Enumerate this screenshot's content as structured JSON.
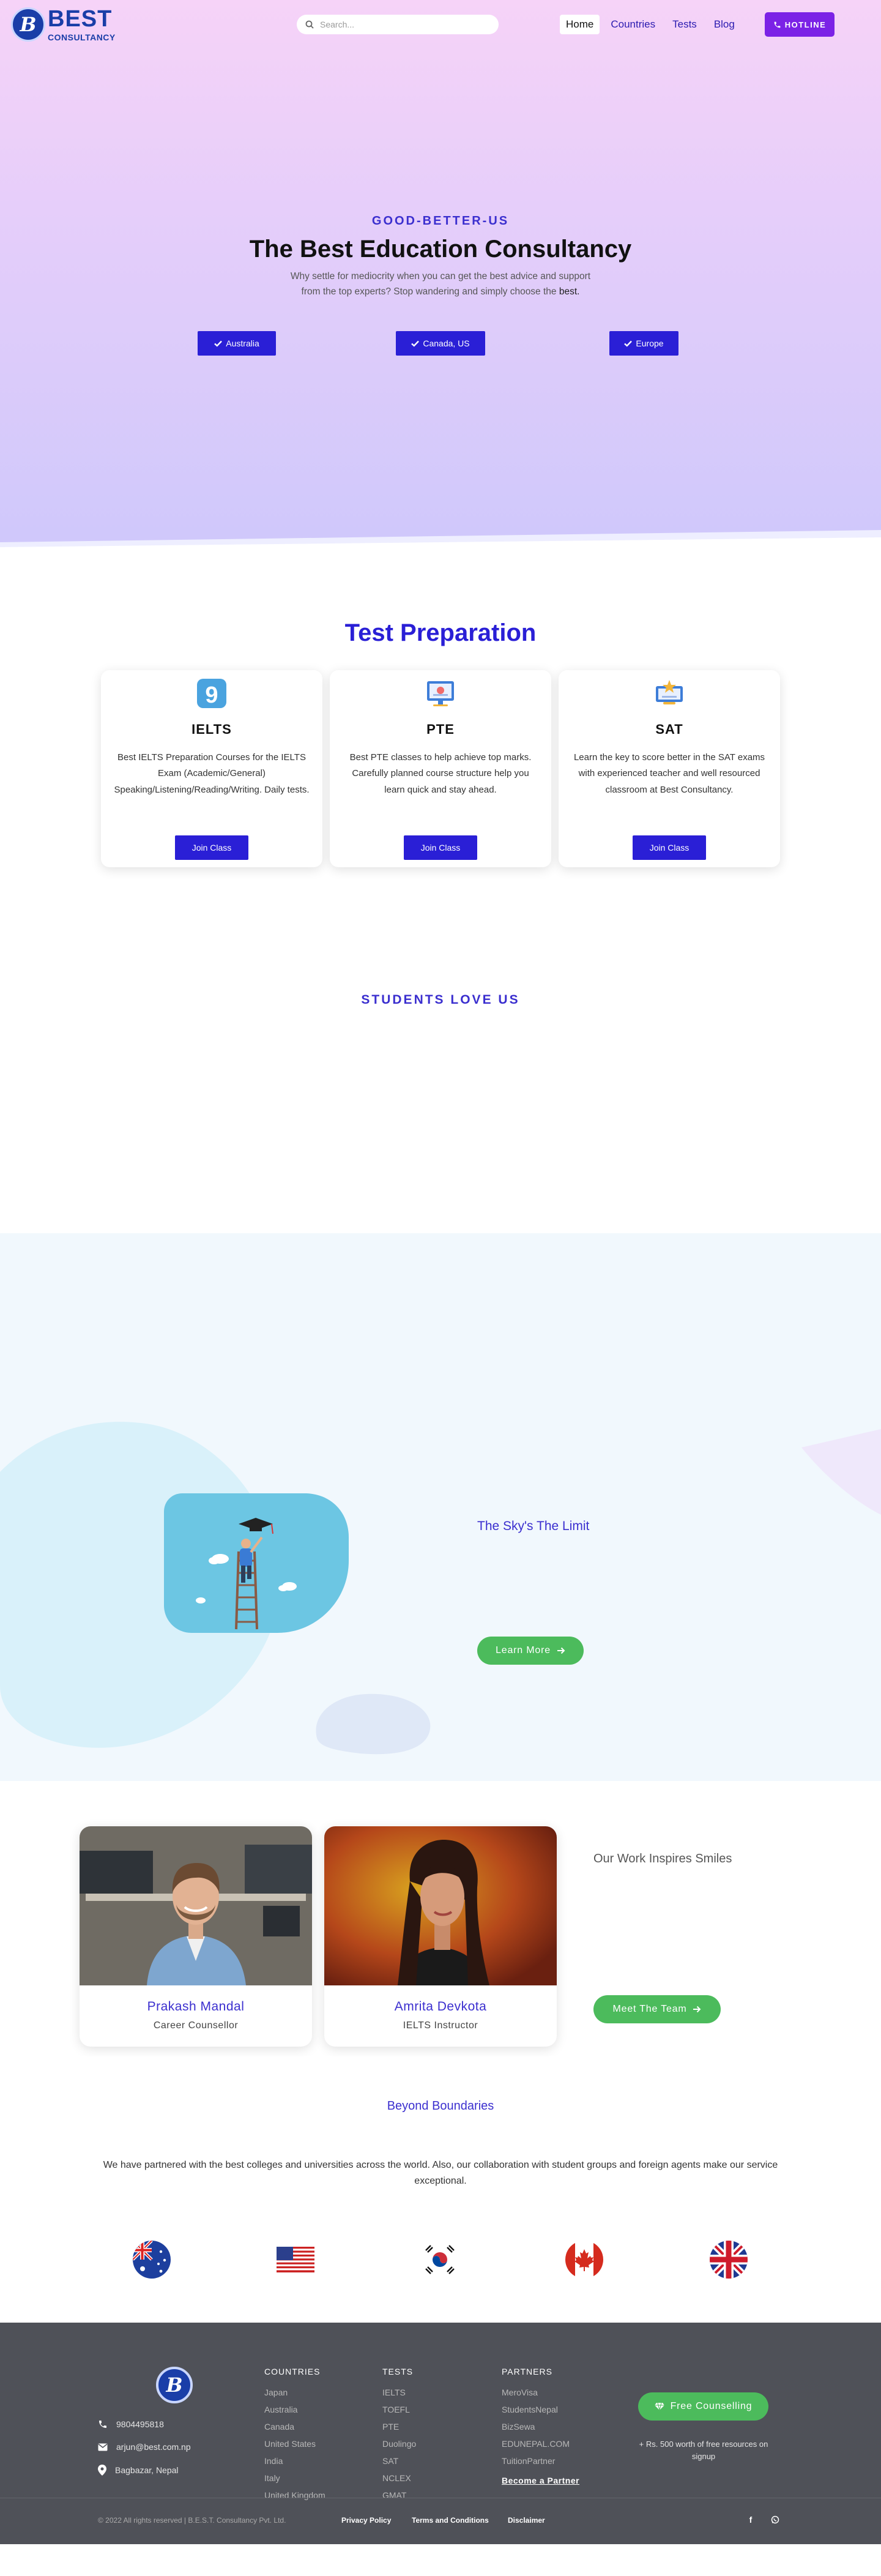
{
  "brand": {
    "logo_letter": "B",
    "name": "BEST",
    "tagline": "CONSULTANCY"
  },
  "search": {
    "placeholder": "Search..."
  },
  "nav": {
    "items": [
      {
        "label": "Home"
      },
      {
        "label": "Countries"
      },
      {
        "label": "Tests"
      },
      {
        "label": "Blog"
      }
    ],
    "hotline_label": "HOTLINE"
  },
  "hero": {
    "eyebrow": "GOOD-BETTER-US",
    "title": "The Best Education Consultancy",
    "description": "Why settle for mediocrity when you can get the best advice and support from the top experts? Stop wandering and simply choose the",
    "description_emphasis": "best.",
    "buttons": [
      {
        "label": "Australia"
      },
      {
        "label": "Canada, US"
      },
      {
        "label": "Europe"
      }
    ]
  },
  "test_prep": {
    "title": "Test Preparation",
    "cards": [
      {
        "name": "IELTS",
        "icon_text": "9",
        "description": "Best IELTS Preparation Courses for the IELTS Exam (Academic/General) Speaking/Listening/Reading/Writing. Daily tests.",
        "button": "Join Class"
      },
      {
        "name": "PTE",
        "description": "Best PTE classes to help achieve top marks. Carefully planned course structure help you learn quick and stay ahead.",
        "button": "Join Class"
      },
      {
        "name": "SAT",
        "description": "Learn the key to score better in the SAT exams with experienced teacher and well resourced classroom at Best Consultancy.",
        "button": "Join Class"
      }
    ]
  },
  "students": {
    "title": "STUDENTS LOVE US"
  },
  "sky": {
    "title": "The Sky's The Limit",
    "button": "Learn More"
  },
  "team": {
    "title": "Our Work Inspires Smiles",
    "button": "Meet The Team",
    "members": [
      {
        "name": "Prakash Mandal",
        "role": "Career Counsellor"
      },
      {
        "name": "Amrita Devkota",
        "role": "IELTS Instructor"
      }
    ]
  },
  "beyond": {
    "title": "Beyond Boundaries",
    "description": "We have partnered with the best colleges and universities across the world. Also, our collaboration with student groups and foreign agents make our service exceptional."
  },
  "footer": {
    "contact": {
      "phone": "9804495818",
      "email": "arjun@best.com.np",
      "address": "Bagbazar, Nepal"
    },
    "countries": {
      "heading": "COUNTRIES",
      "items": [
        "Japan",
        "Australia",
        "Canada",
        "United States",
        "India",
        "Italy",
        "United Kingdom"
      ]
    },
    "tests": {
      "heading": "TESTS",
      "items": [
        "IELTS",
        "TOEFL",
        "PTE",
        "Duolingo",
        "SAT",
        "NCLEX",
        "GMAT"
      ]
    },
    "partners": {
      "heading": "PARTNERS",
      "items": [
        "MeroVisa",
        "StudentsNepal",
        "BizSewa",
        "EDUNEPAL.COM",
        "TuitionPartner"
      ],
      "cta": "Become a Partner"
    },
    "counselling_button": "Free Counselling",
    "counselling_note": "+ Rs. 500 worth of free resources on signup",
    "copyright": "© 2022 All rights reserved | B.E.S.T. Consultancy Pvt. Ltd.",
    "legal": [
      "Privacy Policy",
      "Terms and Conditions",
      "Disclaimer"
    ]
  },
  "colors": {
    "primary": "#2a1fd6",
    "accent": "#7b22e6",
    "green": "#4cbb5c",
    "footer_bg": "#4f5158"
  }
}
